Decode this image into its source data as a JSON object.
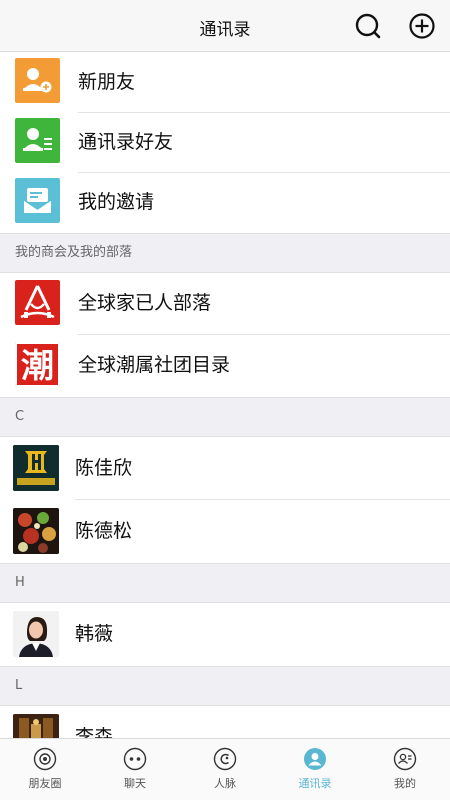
{
  "header": {
    "title": "通讯录"
  },
  "top_items": [
    {
      "label": "新朋友",
      "icon": "add-person-icon",
      "color": "#f39b34"
    },
    {
      "label": "通讯录好友",
      "icon": "contact-card-icon",
      "color": "#3fb63b"
    },
    {
      "label": "我的邀请",
      "icon": "invitation-envelope-icon",
      "color": "#5bbfd6"
    }
  ],
  "groups_section": {
    "label": "我的商会及我的部落"
  },
  "groups": [
    {
      "label": "全球家已人部落",
      "icon": "tribe-logo"
    },
    {
      "label": "全球潮属社团目录",
      "icon": "chao-logo",
      "logo_text": "潮"
    }
  ],
  "contact_sections": [
    {
      "letter": "C",
      "contacts": [
        {
          "name": "陈佳欣",
          "avatar": "brand-logo-avatar"
        },
        {
          "name": "陈德松",
          "avatar": "food-photo-avatar"
        }
      ]
    },
    {
      "letter": "H",
      "contacts": [
        {
          "name": "韩薇",
          "avatar": "woman-portrait-avatar"
        }
      ]
    },
    {
      "letter": "L",
      "contacts": [
        {
          "name": "李森",
          "avatar": "restaurant-photo-avatar"
        }
      ]
    }
  ],
  "tabs": [
    {
      "label": "朋友圈",
      "icon": "camera-lens-icon",
      "active": false
    },
    {
      "label": "聊天",
      "icon": "chat-bubble-icon",
      "active": false
    },
    {
      "label": "人脉",
      "icon": "network-icon",
      "active": false
    },
    {
      "label": "通讯录",
      "icon": "contacts-person-icon",
      "active": true
    },
    {
      "label": "我的",
      "icon": "profile-card-icon",
      "active": false
    }
  ],
  "colors": {
    "accent": "#5ab7d2",
    "section_bg": "#efeff4"
  }
}
